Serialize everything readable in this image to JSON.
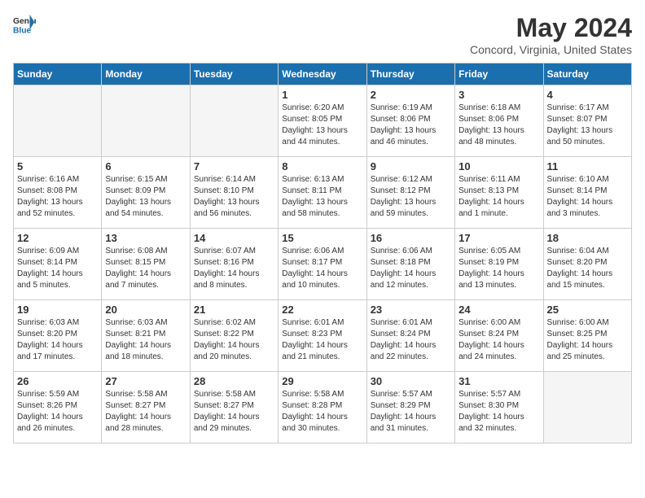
{
  "logo": {
    "general": "General",
    "blue": "Blue"
  },
  "title": "May 2024",
  "location": "Concord, Virginia, United States",
  "days_of_week": [
    "Sunday",
    "Monday",
    "Tuesday",
    "Wednesday",
    "Thursday",
    "Friday",
    "Saturday"
  ],
  "weeks": [
    [
      {
        "day": "",
        "empty": true
      },
      {
        "day": "",
        "empty": true
      },
      {
        "day": "",
        "empty": true
      },
      {
        "day": "1",
        "sunrise": "Sunrise: 6:20 AM",
        "sunset": "Sunset: 8:05 PM",
        "daylight": "Daylight: 13 hours and 44 minutes."
      },
      {
        "day": "2",
        "sunrise": "Sunrise: 6:19 AM",
        "sunset": "Sunset: 8:06 PM",
        "daylight": "Daylight: 13 hours and 46 minutes."
      },
      {
        "day": "3",
        "sunrise": "Sunrise: 6:18 AM",
        "sunset": "Sunset: 8:06 PM",
        "daylight": "Daylight: 13 hours and 48 minutes."
      },
      {
        "day": "4",
        "sunrise": "Sunrise: 6:17 AM",
        "sunset": "Sunset: 8:07 PM",
        "daylight": "Daylight: 13 hours and 50 minutes."
      }
    ],
    [
      {
        "day": "5",
        "sunrise": "Sunrise: 6:16 AM",
        "sunset": "Sunset: 8:08 PM",
        "daylight": "Daylight: 13 hours and 52 minutes."
      },
      {
        "day": "6",
        "sunrise": "Sunrise: 6:15 AM",
        "sunset": "Sunset: 8:09 PM",
        "daylight": "Daylight: 13 hours and 54 minutes."
      },
      {
        "day": "7",
        "sunrise": "Sunrise: 6:14 AM",
        "sunset": "Sunset: 8:10 PM",
        "daylight": "Daylight: 13 hours and 56 minutes."
      },
      {
        "day": "8",
        "sunrise": "Sunrise: 6:13 AM",
        "sunset": "Sunset: 8:11 PM",
        "daylight": "Daylight: 13 hours and 58 minutes."
      },
      {
        "day": "9",
        "sunrise": "Sunrise: 6:12 AM",
        "sunset": "Sunset: 8:12 PM",
        "daylight": "Daylight: 13 hours and 59 minutes."
      },
      {
        "day": "10",
        "sunrise": "Sunrise: 6:11 AM",
        "sunset": "Sunset: 8:13 PM",
        "daylight": "Daylight: 14 hours and 1 minute."
      },
      {
        "day": "11",
        "sunrise": "Sunrise: 6:10 AM",
        "sunset": "Sunset: 8:14 PM",
        "daylight": "Daylight: 14 hours and 3 minutes."
      }
    ],
    [
      {
        "day": "12",
        "sunrise": "Sunrise: 6:09 AM",
        "sunset": "Sunset: 8:14 PM",
        "daylight": "Daylight: 14 hours and 5 minutes."
      },
      {
        "day": "13",
        "sunrise": "Sunrise: 6:08 AM",
        "sunset": "Sunset: 8:15 PM",
        "daylight": "Daylight: 14 hours and 7 minutes."
      },
      {
        "day": "14",
        "sunrise": "Sunrise: 6:07 AM",
        "sunset": "Sunset: 8:16 PM",
        "daylight": "Daylight: 14 hours and 8 minutes."
      },
      {
        "day": "15",
        "sunrise": "Sunrise: 6:06 AM",
        "sunset": "Sunset: 8:17 PM",
        "daylight": "Daylight: 14 hours and 10 minutes."
      },
      {
        "day": "16",
        "sunrise": "Sunrise: 6:06 AM",
        "sunset": "Sunset: 8:18 PM",
        "daylight": "Daylight: 14 hours and 12 minutes."
      },
      {
        "day": "17",
        "sunrise": "Sunrise: 6:05 AM",
        "sunset": "Sunset: 8:19 PM",
        "daylight": "Daylight: 14 hours and 13 minutes."
      },
      {
        "day": "18",
        "sunrise": "Sunrise: 6:04 AM",
        "sunset": "Sunset: 8:20 PM",
        "daylight": "Daylight: 14 hours and 15 minutes."
      }
    ],
    [
      {
        "day": "19",
        "sunrise": "Sunrise: 6:03 AM",
        "sunset": "Sunset: 8:20 PM",
        "daylight": "Daylight: 14 hours and 17 minutes."
      },
      {
        "day": "20",
        "sunrise": "Sunrise: 6:03 AM",
        "sunset": "Sunset: 8:21 PM",
        "daylight": "Daylight: 14 hours and 18 minutes."
      },
      {
        "day": "21",
        "sunrise": "Sunrise: 6:02 AM",
        "sunset": "Sunset: 8:22 PM",
        "daylight": "Daylight: 14 hours and 20 minutes."
      },
      {
        "day": "22",
        "sunrise": "Sunrise: 6:01 AM",
        "sunset": "Sunset: 8:23 PM",
        "daylight": "Daylight: 14 hours and 21 minutes."
      },
      {
        "day": "23",
        "sunrise": "Sunrise: 6:01 AM",
        "sunset": "Sunset: 8:24 PM",
        "daylight": "Daylight: 14 hours and 22 minutes."
      },
      {
        "day": "24",
        "sunrise": "Sunrise: 6:00 AM",
        "sunset": "Sunset: 8:24 PM",
        "daylight": "Daylight: 14 hours and 24 minutes."
      },
      {
        "day": "25",
        "sunrise": "Sunrise: 6:00 AM",
        "sunset": "Sunset: 8:25 PM",
        "daylight": "Daylight: 14 hours and 25 minutes."
      }
    ],
    [
      {
        "day": "26",
        "sunrise": "Sunrise: 5:59 AM",
        "sunset": "Sunset: 8:26 PM",
        "daylight": "Daylight: 14 hours and 26 minutes."
      },
      {
        "day": "27",
        "sunrise": "Sunrise: 5:58 AM",
        "sunset": "Sunset: 8:27 PM",
        "daylight": "Daylight: 14 hours and 28 minutes."
      },
      {
        "day": "28",
        "sunrise": "Sunrise: 5:58 AM",
        "sunset": "Sunset: 8:27 PM",
        "daylight": "Daylight: 14 hours and 29 minutes."
      },
      {
        "day": "29",
        "sunrise": "Sunrise: 5:58 AM",
        "sunset": "Sunset: 8:28 PM",
        "daylight": "Daylight: 14 hours and 30 minutes."
      },
      {
        "day": "30",
        "sunrise": "Sunrise: 5:57 AM",
        "sunset": "Sunset: 8:29 PM",
        "daylight": "Daylight: 14 hours and 31 minutes."
      },
      {
        "day": "31",
        "sunrise": "Sunrise: 5:57 AM",
        "sunset": "Sunset: 8:30 PM",
        "daylight": "Daylight: 14 hours and 32 minutes."
      },
      {
        "day": "",
        "empty": true
      }
    ]
  ]
}
